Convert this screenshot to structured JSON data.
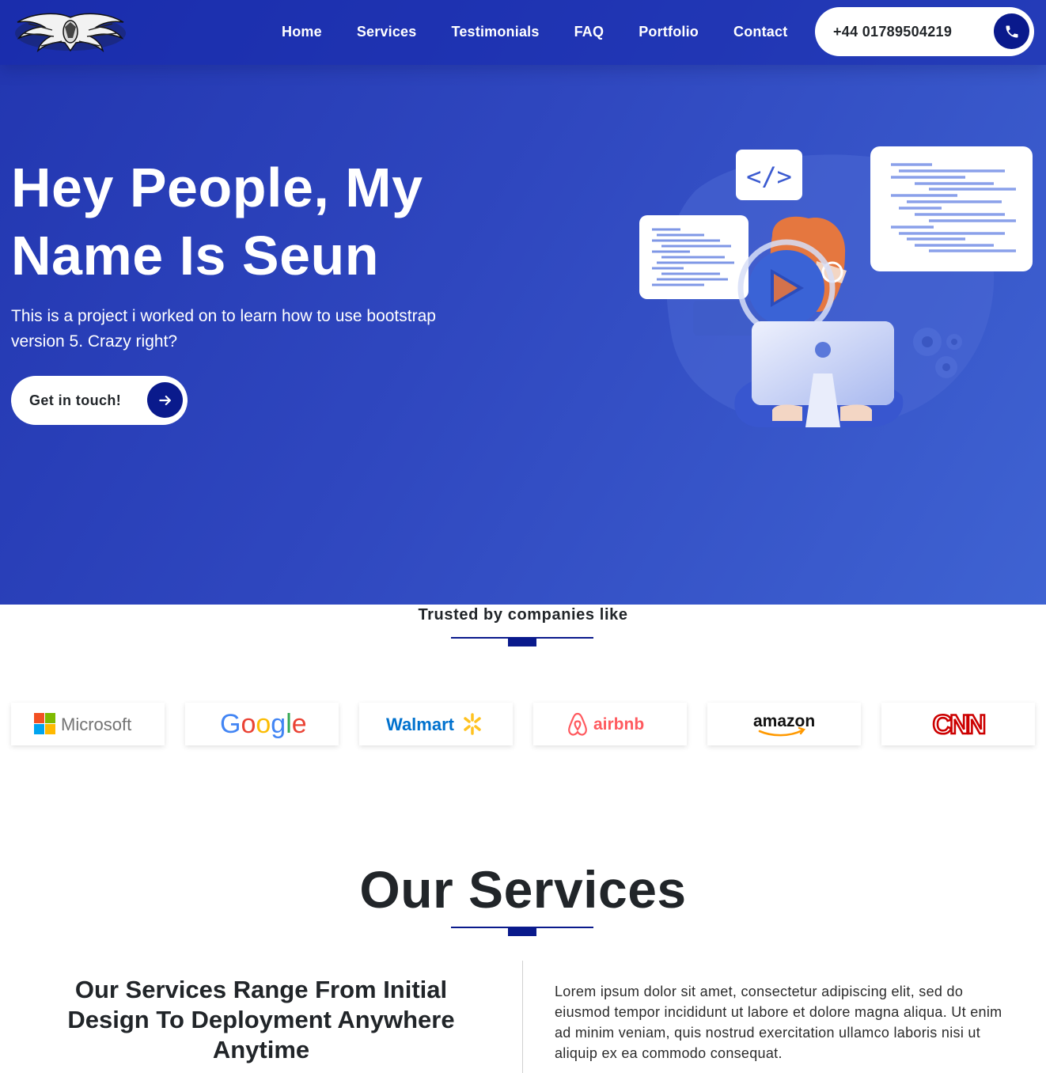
{
  "brand": {
    "logo_icon": "winged-emblem-logo"
  },
  "nav": {
    "links": [
      {
        "label": "Home"
      },
      {
        "label": "Services"
      },
      {
        "label": "Testimonials"
      },
      {
        "label": "FAQ"
      },
      {
        "label": "Portfolio"
      },
      {
        "label": "Contact"
      }
    ],
    "phone": "+44 01789504219",
    "phone_icon": "phone-icon"
  },
  "hero": {
    "title": "Hey People, My Name Is Seun",
    "subtitle": "This is a project i worked on to learn how to use bootstrap version 5. Crazy right?",
    "cta_label": "Get in touch!",
    "cta_icon": "arrow-right-icon",
    "illustration": "developer-at-computer-illustration"
  },
  "trusted": {
    "title": "Trusted by companies like",
    "companies": [
      "Microsoft",
      "Google",
      "Walmart",
      "airbnb",
      "amazon",
      "CNN"
    ]
  },
  "services": {
    "title": "Our Services",
    "heading": "Our Services Range From Initial Design To Deployment Anywhere Anytime",
    "body": "Lorem ipsum dolor sit amet, consectetur adipiscing elit, sed do eiusmod tempor incididunt ut labore et dolore magna aliqua. Ut enim ad minim veniam, quis nostrud exercitation ullamco laboris nisi ut aliquip ex ea commodo consequat."
  },
  "colors": {
    "hero_start": "#2236b0",
    "hero_end": "#3f63d2",
    "accent_navy": "#0a1a8c",
    "text_dark": "#212529"
  }
}
